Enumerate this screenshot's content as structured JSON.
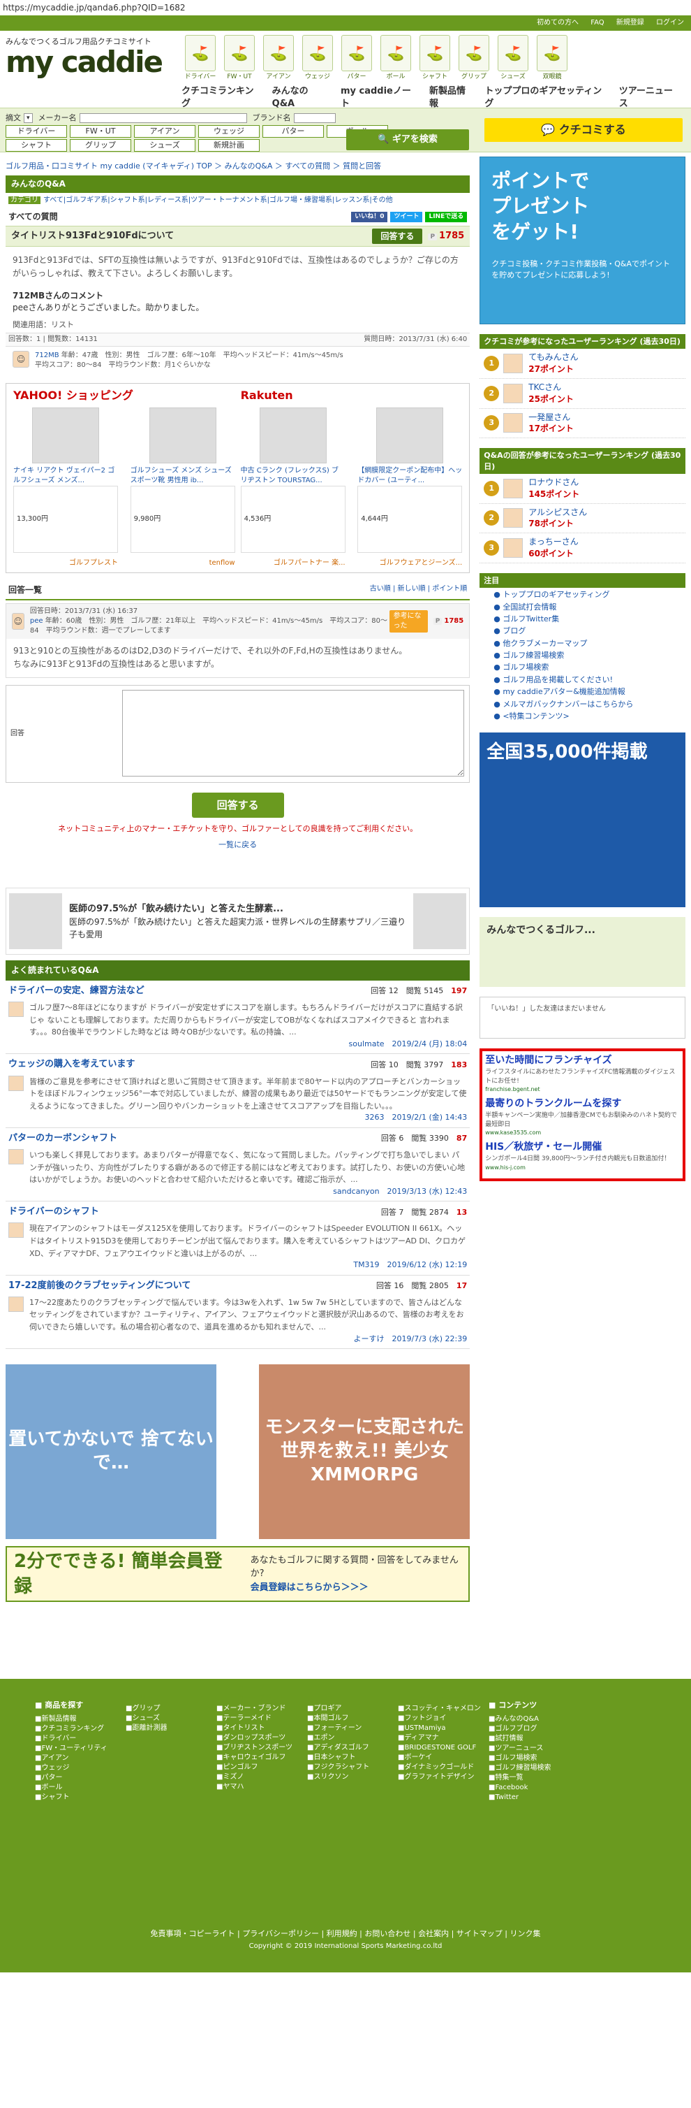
{
  "url": "https://mycaddie.jp/qanda6.php?QID=1682",
  "topbar": {
    "l1": "初めての方へ",
    "l2": "FAQ",
    "l3": "新規登録",
    "l4": "ログイン"
  },
  "logo": {
    "tagline": "みんなでつくるゴルフ用品クチコミサイト",
    "name": "my caddie"
  },
  "categories": [
    "ドライバー",
    "FW・UT",
    "アイアン",
    "ウェッジ",
    "パター",
    "ボール",
    "シャフト",
    "グリップ",
    "シューズ",
    "双眼鏡"
  ],
  "gnav": [
    "クチコミランキング",
    "みんなのQ&A",
    "my caddieノート",
    "新製品情報",
    "トッププロのギアセッティング",
    "ツアーニュース"
  ],
  "search": {
    "type_label": "摘文",
    "maker_label": "メーカー名",
    "brand_label": "ブランド名",
    "buttons": [
      "ドライバー",
      "FW・UT",
      "アイアン",
      "ウェッジ",
      "パター",
      "ボール",
      "シャフト",
      "グリップ",
      "シューズ",
      "新規計画"
    ],
    "gear_button": "ギアを検索",
    "kuchikomi_button": "クチコミする"
  },
  "breadcrumb": "ゴルフ用品・口コミサイト my caddie (マイキャディ) TOP ＞ みんなのQ&A ＞ すべての質問 ＞ 質問と回答",
  "section_title": "みんなのQ&A",
  "tabs": {
    "label": "カテゴリ",
    "text": "すべて|ゴルフギア系|シャフト系|レディース系|ツアー・トーナメント系|ゴルフ場・練習場系|レッスン系|その他"
  },
  "all_questions": "すべての質問",
  "share": {
    "fb": "いいね！0",
    "tw": "ツイート",
    "line": "LINEで送る"
  },
  "question": {
    "title": "タイトリスト913Fdと910Fdについて",
    "answer_button": "回答する",
    "points": "1785",
    "body": "913Fdと913Fdでは、SFTの互換性は無いようですが、913Fdと910Fdでは、互換性はあるのでしょうか？ご存じの方がいらっしゃれば、教えて下さい。よろしくお願いします。",
    "comment_head": "712MBさんのコメント",
    "comment_body": "peeさんありがとうございました。助かりました。",
    "related": "関連用語：リスト",
    "meta_left": "回答数：1 | 閲覧数：14131",
    "meta_right": "質問日時：2013/7/31 (水) 6:40",
    "user_name": "712MB",
    "user_info1": "年齢：47歳　性別：男性　ゴルフ歴：6年〜10年　平均ヘッドスピード：41m/s〜45m/s",
    "user_info2": "平均スコア：80〜84　平均ラウンド数：月1ぐらいかな"
  },
  "yahoo": {
    "title": "YAHOO! ショッピング",
    "items": [
      {
        "name": "ナイキ リアクト ヴェイパー2 ゴルフシューズ メンズ...",
        "price": "13,300円",
        "shop": "ゴルフプレスト"
      },
      {
        "name": "ゴルフシューズ メンズ シューズ スポーツ靴 男性用 ib...",
        "price": "9,980円",
        "shop": "tenflow"
      }
    ]
  },
  "rakuten": {
    "title": "Rakuten",
    "items": [
      {
        "name": "中古 Cランク (フレックスS) ブリヂストン TOURSTAG...",
        "price": "4,536円",
        "shop": "ゴルフパートナー 楽..."
      },
      {
        "name": "【網膜限定クーポン配布中】ヘッドカバー (ユーティ...",
        "price": "4,644円",
        "shop": "ゴルフウェアとジーンズ..."
      }
    ]
  },
  "answers_head": "回答一覧",
  "answers_sort": "古い順 | 新しい順 | ポイント順",
  "answer": {
    "date": "回答日時：2013/7/31 (水) 16:37",
    "user": "pee",
    "info": "年齢：60歳　性別：男性　ゴルフ歴：21年以上　平均ヘッドスピード：41m/s〜45m/s　平均スコア：80〜84　平均ラウンド数：週一でプレーしてます",
    "help": "参考になった",
    "points": "1785",
    "body1": "913と910との互換性があるのはD2,D3のドライバーだけで、それ以外のF,Fd,Hの互換性はありません。",
    "body2": "ちなみに913Fと913Fdの互換性はあると思いますが。"
  },
  "form": {
    "label": "回答",
    "submit": "回答する",
    "manner": "ネットコミュニティ上のマナー・エチケットを守り、ゴルファーとしての良識を持ってご利用ください。",
    "back": "一覧に戻る"
  },
  "pr": {
    "title": "医師の97.5%が「飲み続けたい」と答えた生酵素...",
    "body": "医師の97.5%が「飲み続けたい」と答えた超実力派・世界レベルの生酵素サプリ／三邉り子も愛用",
    "tag": "PR"
  },
  "popular": {
    "head": "よく読まれているQ&A",
    "items": [
      {
        "title": "ドライバーの安定、練習方法など",
        "ans": "12",
        "views": "5145",
        "pt": "197",
        "body": "ゴルフ歴7〜8年ほどになりますが ドライバーが安定せずにスコアを崩します。もちろんドライバーだけがスコアに直結する訳じゃ ないことも理解しております。ただ周りからもドライバーが安定してOBがなくなればスコアメイクできると 言われます。。。80台後半でラウンドした時などは 時々OBが少ないです。私の持論、...",
        "user": "soulmate",
        "date": "2019/2/4 (月) 18:04"
      },
      {
        "title": "ウェッジの購入を考えています",
        "ans": "10",
        "views": "3797",
        "pt": "183",
        "body": "皆様のご意見を参考にさせて頂ければと思いご質問させて頂きます。半年前まで80ヤード以内のアプローチとバンカーショットをほぼドルフィンウェッジ56°一本で対応していましたが、練習の成果もあり最近では50ヤードでもランニングが安定して使えるようになってきました。グリーン回りやバンカーショットを上達させてスコアアップを目指したい。。。",
        "user": "3263",
        "date": "2019/2/1 (金) 14:43"
      },
      {
        "title": "パターのカーボンシャフト",
        "ans": "6",
        "views": "3390",
        "pt": "87",
        "body": "いつも楽しく拝見しております。あまりパターが得意でなく、気になって質問しました。パッティングで打ち急いでしまい パンチが強いったり、方向性がブレたりする癖があるので修正する前にはなど考えております。試打したり、お使いの方使い心地はいかがでしょうか。お使いのヘッドと合わせて紹介いただけると幸いです。確認ご指示が、...",
        "user": "sandcanyon",
        "date": "2019/3/13 (水) 12:43"
      },
      {
        "title": "ドライバーのシャフト",
        "ans": "7",
        "views": "2874",
        "pt": "13",
        "body": "現在アイアンのシャフトはモーダス125Xを使用しております。ドライバーのシャフトはSpeeder EVOLUTION II 661X。ヘッドはタイトリスト915D3を使用しておりチーピンが出て悩んでおります。購入を考えているシャフトはツアーAD DI、クロカゲXD、ディアマナDF、フェアウエイウッドと違いは上がるのが、...",
        "user": "TM319",
        "date": "2019/6/12 (水) 12:19"
      },
      {
        "title": "17-22度前後のクラブセッティングについて",
        "ans": "16",
        "views": "2805",
        "pt": "17",
        "body": "17〜22度あたりのクラブセッティングで悩んでいます。今は3wを入れず、1w 5w 7w 5Hとしていますので、皆さんはどんなセッティングをされていますか？ユーティリティ、アイアン、フェアウェイウッドと選択肢が沢山あるので、皆様のお考えをお伺いできたら嬉しいです。私の場合初心者なので、道具を進めるかも知れませんで、...",
        "user": "よーすけ",
        "date": "2019/7/3 (水) 22:39"
      }
    ]
  },
  "banners": {
    "left": "置いてかないで 捨てないで…",
    "right": "モンスターに支配された世界を救え!! 美少女XMMORPG"
  },
  "register": {
    "main": "2分でできる! 簡単会員登録",
    "sub": "あなたもゴルフに関する質問・回答をしてみませんか?",
    "link": "会員登録はこちらから＞＞＞"
  },
  "side": {
    "promo": "ポイントでプレゼントをゲット!",
    "promo_sub": "クチコミ投稿・クチコミ作業投稿・Q&Aでポイントを貯めてプレゼントに応募しよう!",
    "ranking1_head": "クチコミが参考になったユーザーランキング (過去30日)",
    "ranking1": [
      {
        "n": "1",
        "name": "てもみんさん",
        "pt": "27ポイント"
      },
      {
        "n": "2",
        "name": "TKCさん",
        "pt": "25ポイント"
      },
      {
        "n": "3",
        "name": "一発屋さん",
        "pt": "17ポイント"
      }
    ],
    "ranking2_head": "Q&Aの回答が参考になったユーザーランキング (過去30日)",
    "ranking2": [
      {
        "n": "1",
        "name": "ロナウドさん",
        "pt": "145ポイント"
      },
      {
        "n": "2",
        "name": "アルシピスさん",
        "pt": "78ポイント"
      },
      {
        "n": "3",
        "name": "まっちーさん",
        "pt": "60ポイント"
      }
    ],
    "links_head": "注目",
    "links": [
      "トッププロのギアセッティング",
      "全国試打会情報",
      "ゴルフTwitter集",
      "ブログ",
      "他クラブメーカーマップ",
      "ゴルフ練習場検索",
      "ゴルフ場検索",
      "ゴルフ用品を掲載してください!",
      "my caddieアバター&機能追加情報",
      "メルマガバックナンバーはこちらから",
      "<特集コンテンツ>"
    ],
    "home_ad": "全国35,000件掲載",
    "mycaddie_card": "みんなでつくるゴルフ...",
    "like_text": "「いいね！」した友達はまだいません",
    "ads": [
      {
        "h": "至いた時間にフランチャイズ",
        "s": "ライフスタイルにあわせたフランチャイズFC情報満載のダイジェストにお任せ!",
        "u": "franchise.bgent.net"
      },
      {
        "h": "最寄りのトランクルームを探す",
        "s": "半額キャンペーン実施中／加藤香澄CMでもお馴染みのハネト契約で最短即日",
        "u": "www.kase3535.com"
      },
      {
        "h": "HIS／秋旅ザ・セール開催",
        "s": "シンガポール4日間 39,800円～ランチ付き内観光も日数追加付！",
        "u": "www.his-j.com"
      }
    ]
  },
  "footer": {
    "cols": [
      {
        "h": "商品を探す",
        "items": [
          "新製品情報",
          "クチコミランキング",
          "ドライバー",
          "FW・ユーティリティ",
          "アイアン",
          "ウェッジ",
          "パター",
          "ボール",
          "シャフト"
        ]
      },
      {
        "h": "",
        "items": [
          "グリップ",
          "シューズ",
          "距離計測器"
        ]
      },
      {
        "h": "",
        "items": [
          "メーカー・ブランド",
          "テーラーメイド",
          "タイトリスト",
          "ダンロップスポーツ",
          "ブリヂストンスポーツ",
          "キャロウェイゴルフ",
          "ピンゴルフ",
          "ミズノ",
          "ヤマハ"
        ]
      },
      {
        "h": "",
        "items": [
          "プロギア",
          "本間ゴルフ",
          "フォーティーン",
          "エポン",
          "アディダスゴルフ",
          "日本シャフト",
          "フジクラシャフト",
          "スリクソン"
        ]
      },
      {
        "h": "",
        "items": [
          "スコッティ・キャメロン",
          "フットジョイ",
          "USTMamiya",
          "ディアマナ",
          "BRIDGESTONE GOLF",
          "ボーケイ",
          "ダイナミックゴールド",
          "グラファイトデザイン"
        ]
      },
      {
        "h": "コンテンツ",
        "items": [
          "みんなのQ&A",
          "ゴルフブログ",
          "試打情報",
          "ツアーニュース",
          "ゴルフ場検索",
          "ゴルフ練習場検索",
          "特集一覧",
          "Facebook",
          "Twitter"
        ]
      }
    ],
    "bottom": "免責事項・コピーライト | プライバシーポリシー | 利用規約 | お問い合わせ | 会社案内 | サイトマップ | リンク集",
    "copy": "Copyright © 2019 International Sports Marketing.co.ltd"
  }
}
